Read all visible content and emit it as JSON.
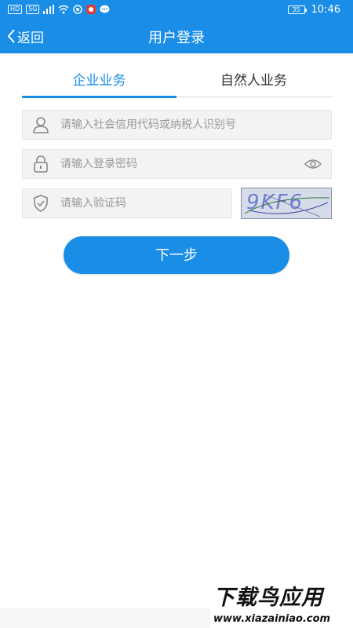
{
  "status_bar": {
    "chips": [
      "HD",
      "5G"
    ],
    "battery": "35",
    "time": "10:46"
  },
  "header": {
    "back_label": "返回",
    "title": "用户登录"
  },
  "tabs": [
    {
      "label": "企业业务",
      "active": true
    },
    {
      "label": "自然人业务",
      "active": false
    }
  ],
  "form": {
    "id_placeholder": "请输入社会信用代码或纳税人识别号",
    "password_placeholder": "请输入登录密码",
    "captcha_placeholder": "请输入验证码",
    "captcha_text": "9KF6"
  },
  "next_button": "下一步",
  "watermark": {
    "brand": "下载鸟应用",
    "url": "www.xiazainiao.com"
  },
  "colors": {
    "primary": "#1a8de6",
    "background": "#f6f6f6"
  }
}
